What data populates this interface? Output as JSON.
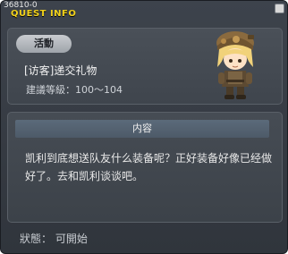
{
  "window": {
    "quest_id": "36810-0",
    "title": "QUEST INFO"
  },
  "quest": {
    "category": "活動",
    "name": "[访客]递交礼物",
    "level_range": "建議等級：100～104"
  },
  "npc": {
    "icon": "npc-portrait-icon"
  },
  "content": {
    "header": "内容",
    "description": "凯利到底想送队友什么装备呢？正好装备好像已经做好了。去和凯利谈谈吧。"
  },
  "status": {
    "text": "狀態：  可開始"
  },
  "colors": {
    "title": "#f2d21c",
    "background": "#353a42"
  }
}
